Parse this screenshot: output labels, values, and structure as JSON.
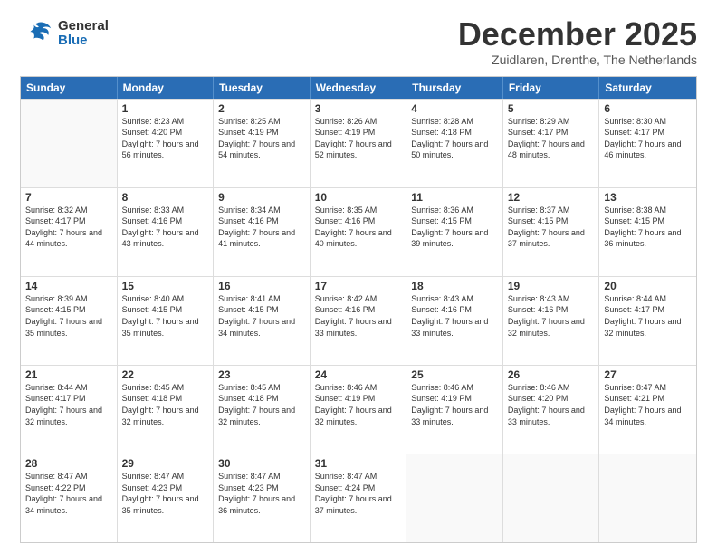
{
  "logo": {
    "general": "General",
    "blue": "Blue"
  },
  "title": "December 2025",
  "subtitle": "Zuidlaren, Drenthe, The Netherlands",
  "days_of_week": [
    "Sunday",
    "Monday",
    "Tuesday",
    "Wednesday",
    "Thursday",
    "Friday",
    "Saturday"
  ],
  "weeks": [
    [
      {
        "day": "",
        "info": ""
      },
      {
        "day": "1",
        "info": "Sunrise: 8:23 AM\nSunset: 4:20 PM\nDaylight: 7 hours\nand 56 minutes."
      },
      {
        "day": "2",
        "info": "Sunrise: 8:25 AM\nSunset: 4:19 PM\nDaylight: 7 hours\nand 54 minutes."
      },
      {
        "day": "3",
        "info": "Sunrise: 8:26 AM\nSunset: 4:19 PM\nDaylight: 7 hours\nand 52 minutes."
      },
      {
        "day": "4",
        "info": "Sunrise: 8:28 AM\nSunset: 4:18 PM\nDaylight: 7 hours\nand 50 minutes."
      },
      {
        "day": "5",
        "info": "Sunrise: 8:29 AM\nSunset: 4:17 PM\nDaylight: 7 hours\nand 48 minutes."
      },
      {
        "day": "6",
        "info": "Sunrise: 8:30 AM\nSunset: 4:17 PM\nDaylight: 7 hours\nand 46 minutes."
      }
    ],
    [
      {
        "day": "7",
        "info": ""
      },
      {
        "day": "8",
        "info": "Sunrise: 8:33 AM\nSunset: 4:16 PM\nDaylight: 7 hours\nand 43 minutes."
      },
      {
        "day": "9",
        "info": "Sunrise: 8:34 AM\nSunset: 4:16 PM\nDaylight: 7 hours\nand 41 minutes."
      },
      {
        "day": "10",
        "info": "Sunrise: 8:35 AM\nSunset: 4:16 PM\nDaylight: 7 hours\nand 40 minutes."
      },
      {
        "day": "11",
        "info": "Sunrise: 8:36 AM\nSunset: 4:15 PM\nDaylight: 7 hours\nand 39 minutes."
      },
      {
        "day": "12",
        "info": "Sunrise: 8:37 AM\nSunset: 4:15 PM\nDaylight: 7 hours\nand 37 minutes."
      },
      {
        "day": "13",
        "info": "Sunrise: 8:38 AM\nSunset: 4:15 PM\nDaylight: 7 hours\nand 36 minutes."
      }
    ],
    [
      {
        "day": "14",
        "info": ""
      },
      {
        "day": "15",
        "info": "Sunrise: 8:40 AM\nSunset: 4:15 PM\nDaylight: 7 hours\nand 35 minutes."
      },
      {
        "day": "16",
        "info": "Sunrise: 8:41 AM\nSunset: 4:15 PM\nDaylight: 7 hours\nand 34 minutes."
      },
      {
        "day": "17",
        "info": "Sunrise: 8:42 AM\nSunset: 4:16 PM\nDaylight: 7 hours\nand 33 minutes."
      },
      {
        "day": "18",
        "info": "Sunrise: 8:43 AM\nSunset: 4:16 PM\nDaylight: 7 hours\nand 33 minutes."
      },
      {
        "day": "19",
        "info": "Sunrise: 8:43 AM\nSunset: 4:16 PM\nDaylight: 7 hours\nand 32 minutes."
      },
      {
        "day": "20",
        "info": "Sunrise: 8:44 AM\nSunset: 4:17 PM\nDaylight: 7 hours\nand 32 minutes."
      }
    ],
    [
      {
        "day": "21",
        "info": ""
      },
      {
        "day": "22",
        "info": "Sunrise: 8:45 AM\nSunset: 4:18 PM\nDaylight: 7 hours\nand 32 minutes."
      },
      {
        "day": "23",
        "info": "Sunrise: 8:45 AM\nSunset: 4:18 PM\nDaylight: 7 hours\nand 32 minutes."
      },
      {
        "day": "24",
        "info": "Sunrise: 8:46 AM\nSunset: 4:19 PM\nDaylight: 7 hours\nand 32 minutes."
      },
      {
        "day": "25",
        "info": "Sunrise: 8:46 AM\nSunset: 4:19 PM\nDaylight: 7 hours\nand 33 minutes."
      },
      {
        "day": "26",
        "info": "Sunrise: 8:46 AM\nSunset: 4:20 PM\nDaylight: 7 hours\nand 33 minutes."
      },
      {
        "day": "27",
        "info": "Sunrise: 8:47 AM\nSunset: 4:21 PM\nDaylight: 7 hours\nand 34 minutes."
      }
    ],
    [
      {
        "day": "28",
        "info": "Sunrise: 8:47 AM\nSunset: 4:22 PM\nDaylight: 7 hours\nand 34 minutes."
      },
      {
        "day": "29",
        "info": "Sunrise: 8:47 AM\nSunset: 4:23 PM\nDaylight: 7 hours\nand 35 minutes."
      },
      {
        "day": "30",
        "info": "Sunrise: 8:47 AM\nSunset: 4:23 PM\nDaylight: 7 hours\nand 36 minutes."
      },
      {
        "day": "31",
        "info": "Sunrise: 8:47 AM\nSunset: 4:24 PM\nDaylight: 7 hours\nand 37 minutes."
      },
      {
        "day": "",
        "info": ""
      },
      {
        "day": "",
        "info": ""
      },
      {
        "day": "",
        "info": ""
      }
    ]
  ],
  "week1_sun": {
    "day": "7",
    "info": "Sunrise: 8:32 AM\nSunset: 4:17 PM\nDaylight: 7 hours\nand 44 minutes."
  },
  "week2_sun": {
    "day": "14",
    "info": "Sunrise: 8:39 AM\nSunset: 4:15 PM\nDaylight: 7 hours\nand 35 minutes."
  },
  "week3_sun": {
    "day": "21",
    "info": "Sunrise: 8:44 AM\nSunset: 4:17 PM\nDaylight: 7 hours\nand 32 minutes."
  }
}
